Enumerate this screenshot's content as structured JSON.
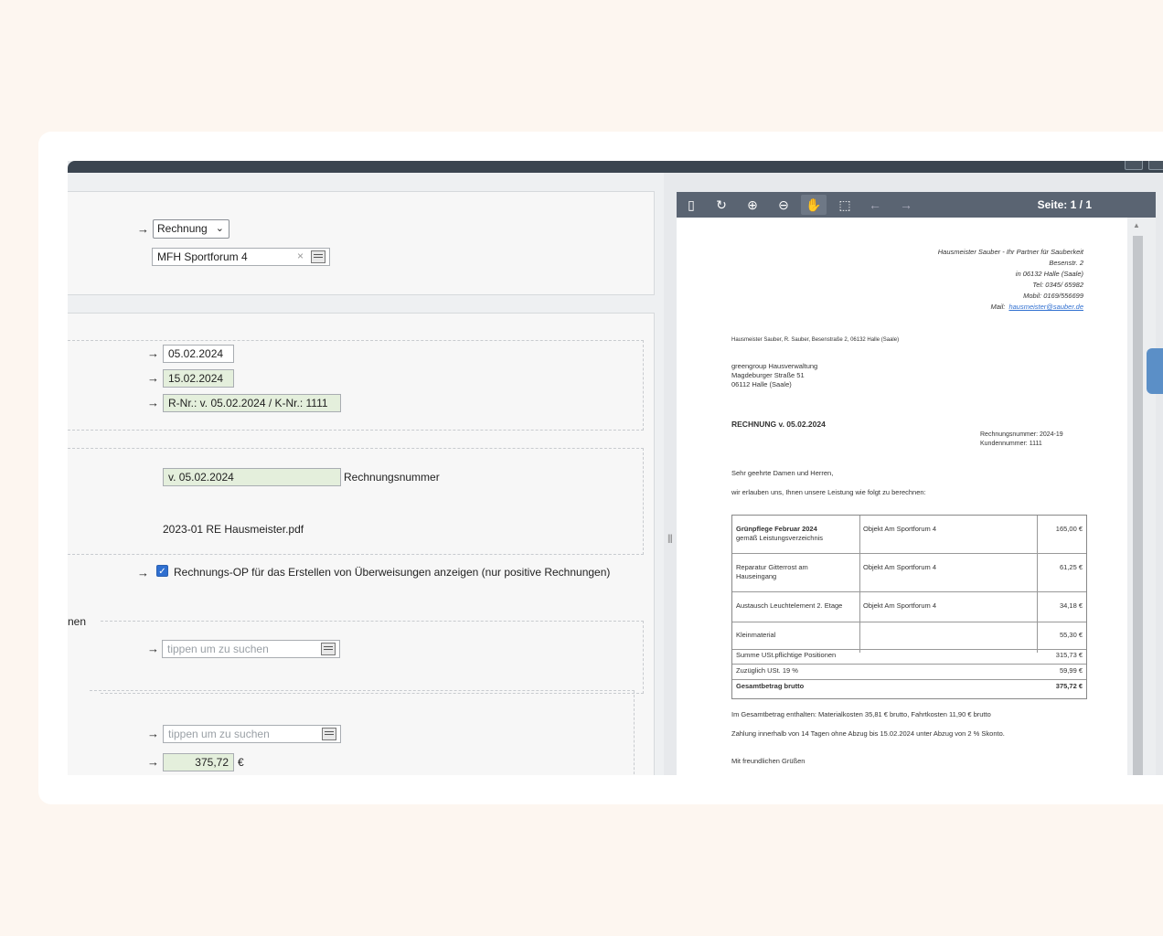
{
  "form": {
    "doc_type": "Rechnung",
    "property": "MFH Sportforum 4",
    "date1": "05.02.2024",
    "date2": "15.02.2024",
    "reference": "R-Nr.: v. 05.02.2024 / K-Nr.: 1111",
    "invoice_number_value": "v. 05.02.2024",
    "invoice_number_label": "Rechnungsnummer",
    "file_name": "2023-01 RE Hausmeister.pdf",
    "checkbox_label": "Rechnungs-OP für das Erstellen von Überweisungen anzeigen (nur positive Rechnungen)",
    "section_label_partial": "nen",
    "search_placeholder_1": "tippen um zu suchen",
    "search_placeholder_2": "tippen um zu suchen",
    "amount": "375,72",
    "currency": "€",
    "arrow": "→",
    "clear_glyph": "×",
    "chevron": "⌄"
  },
  "viewer": {
    "page_info": "Seite: 1 / 1",
    "tools": [
      "sidebar-icon",
      "rotate-icon",
      "zoom-in-icon",
      "zoom-out-icon",
      "hand-icon",
      "select-icon",
      "prev-icon",
      "next-icon"
    ]
  },
  "document": {
    "sender": [
      "Hausmeister Sauber - Ihr Partner für Sauberkeit",
      "Besenstr. 2",
      "in 06132 Halle (Saale)",
      "Tel: 0345/ 65982",
      "Mobil: 0169/556699"
    ],
    "mail_label": "Mail:",
    "mail": "hausmeister@sauber.de",
    "sender_line": "Hausmeister Sauber, R. Sauber, Besenstraße 2, 06132 Halle (Saale)",
    "recipient": [
      "greengroup Hausverwaltung",
      "Magdeburger Straße 51",
      "06112 Halle (Saale)"
    ],
    "title": "RECHNUNG v. 05.02.2024",
    "meta": [
      "Rechnungsnummer: 2024-19",
      "Kundennummer: 1111"
    ],
    "greeting": "Sehr geehrte Damen und Herren,",
    "intro": "wir erlauben uns, Ihnen unsere Leistung wie folgt zu berechnen:",
    "rows": [
      {
        "desc": "Grünpflege Februar 2024",
        "desc2": "gemäß Leistungsverzeichnis",
        "obj": "Objekt Am Sportforum 4",
        "amt": "165,00 €"
      },
      {
        "desc": "Reparatur Gitterrost am",
        "desc2": "Hauseingang",
        "obj": "Objekt Am Sportforum 4",
        "amt": "61,25 €"
      },
      {
        "desc": "Austausch Leuchtelement 2. Etage",
        "desc2": "",
        "obj": "Objekt Am Sportforum 4",
        "amt": "34,18 €"
      },
      {
        "desc": "Kleinmaterial",
        "desc2": "",
        "obj": "",
        "amt": "55,30 €"
      }
    ],
    "sum_label": "Summe USt.pflichtige Positionen",
    "sum_value": "315,73 €",
    "tax_label": "Zuzüglich USt. 19 %",
    "tax_value": "59,99 €",
    "total_label": "Gesamtbetrag brutto",
    "total_value": "375,72 €",
    "note1": "Im Gesamtbetrag enthalten: Materialkosten 35,81 € brutto, Fahrtkosten 11,90 € brutto",
    "note2": "Zahlung innerhalb von 14 Tagen ohne Abzug bis 15.02.2024 unter Abzug von 2 % Skonto.",
    "closing": "Mit freundlichen Grüßen"
  }
}
